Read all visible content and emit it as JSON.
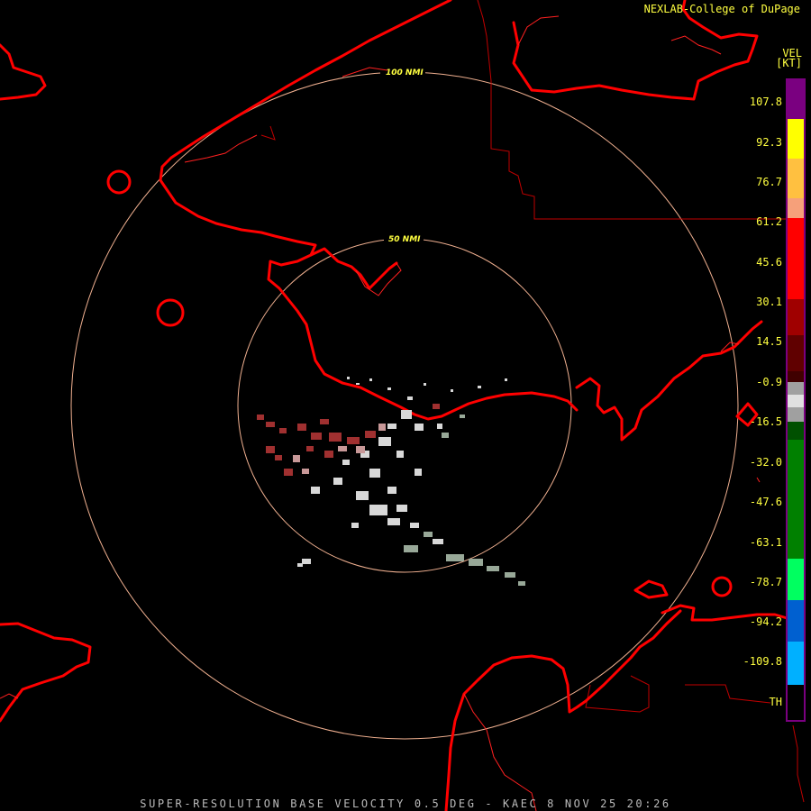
{
  "header": {
    "credit": "NEXLAB-College of DuPage",
    "product_code": "VEL",
    "unit": "[KT]"
  },
  "rings": [
    {
      "label": "100 NMI"
    },
    {
      "label": "50 NMI"
    }
  ],
  "legend": {
    "labels": [
      "107.8",
      "92.3",
      "76.7",
      "61.2",
      "45.6",
      "30.1",
      "14.5",
      "-0.9",
      "-16.5",
      "-32.0",
      "-47.6",
      "-63.1",
      "-78.7",
      "-94.2",
      "-109.8",
      "TH"
    ],
    "colors": {
      "top": "#7a0080",
      "yellow": "#ffff00",
      "salmon": "#f6a07a",
      "red": "#ff0000",
      "dark_red": "#400000",
      "gray": "#a0a0a0",
      "green": "#00c000",
      "bright_green": "#00ff60",
      "blue": "#0060d0",
      "cyan": "#00b0ff",
      "th": "#3a0040"
    }
  },
  "map_colors": {
    "coast": "#ff0000",
    "county_lines": "#c00000",
    "rings": "#f0b090"
  },
  "caption": "SUPER-RESOLUTION BASE VELOCITY 0.5 DEG - KAEC 8 NOV 25 20:26"
}
